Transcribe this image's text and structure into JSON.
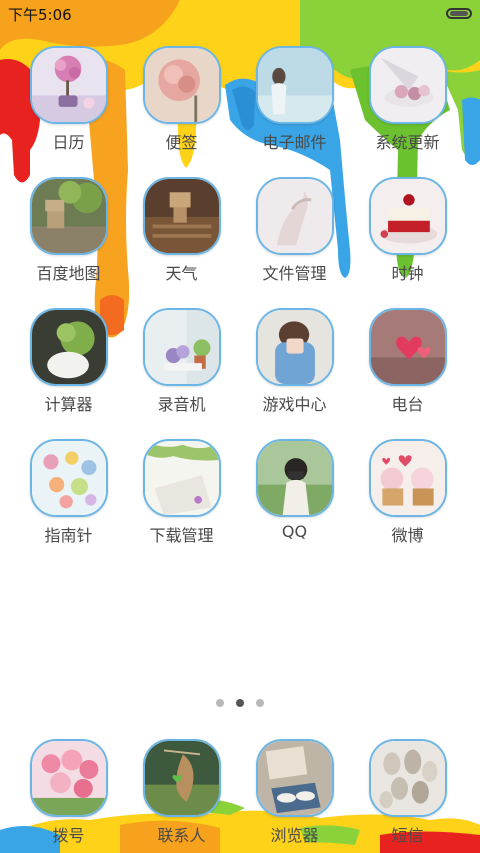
{
  "status_bar": {
    "time": "下午5:06"
  },
  "apps": [
    {
      "label": "日历",
      "icon": "calendar-icon"
    },
    {
      "label": "便签",
      "icon": "notes-icon"
    },
    {
      "label": "电子邮件",
      "icon": "email-icon"
    },
    {
      "label": "系统更新",
      "icon": "system-update-icon"
    },
    {
      "label": "百度地图",
      "icon": "baidu-map-icon"
    },
    {
      "label": "天气",
      "icon": "weather-icon"
    },
    {
      "label": "文件管理",
      "icon": "file-manager-icon"
    },
    {
      "label": "时钟",
      "icon": "clock-icon"
    },
    {
      "label": "计算器",
      "icon": "calculator-icon"
    },
    {
      "label": "录音机",
      "icon": "recorder-icon"
    },
    {
      "label": "游戏中心",
      "icon": "game-center-icon"
    },
    {
      "label": "电台",
      "icon": "radio-icon"
    },
    {
      "label": "指南针",
      "icon": "compass-icon"
    },
    {
      "label": "下载管理",
      "icon": "download-manager-icon"
    },
    {
      "label": "QQ",
      "icon": "qq-icon"
    },
    {
      "label": "微博",
      "icon": "weibo-icon"
    }
  ],
  "page_indicator": {
    "pages": 3,
    "current_page": 2
  },
  "dock": [
    {
      "label": "拨号",
      "icon": "dialer-icon"
    },
    {
      "label": "联系人",
      "icon": "contacts-icon"
    },
    {
      "label": "浏览器",
      "icon": "browser-icon"
    },
    {
      "label": "短信",
      "icon": "messages-icon"
    }
  ],
  "colors": {
    "icon_border": "#6bb6e6",
    "label_text": "#4a4a4a",
    "dot_active": "#555555",
    "dot_inactive": "#b8b8b8"
  }
}
